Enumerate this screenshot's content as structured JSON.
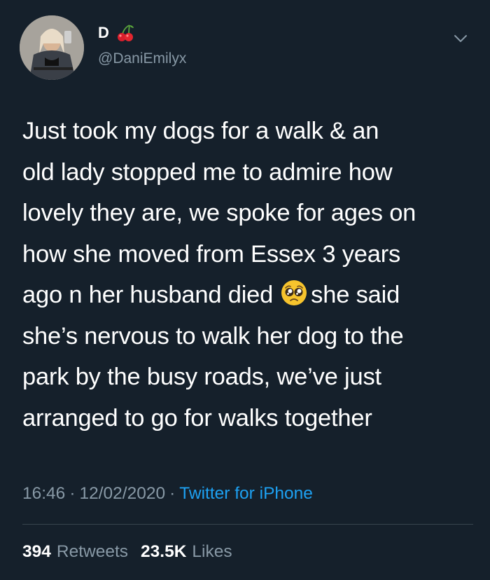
{
  "tweet": {
    "author": {
      "display_name": "D",
      "name_emoji": "cherries-icon",
      "handle": "@DaniEmilyx",
      "avatar": "avatar"
    },
    "text_lines": [
      "Just took my dogs for a walk & an",
      "old lady stopped me to admire how",
      "lovely they are, we spoke for ages on",
      "how she moved from Essex 3 years",
      "ago n her husband died",
      "she said",
      "she’s nervous to walk her dog to the",
      "park by the busy roads, we’ve just",
      "arranged to go for walks together"
    ],
    "inline_emoji": "pleading-face-icon",
    "meta": {
      "time": "16:46",
      "separator": "·",
      "date": "12/02/2020",
      "source": "Twitter for iPhone"
    },
    "stats": {
      "retweets_count": "394",
      "retweets_label": "Retweets",
      "likes_count": "23.5K",
      "likes_label": "Likes"
    },
    "menu_icon": "chevron-down-icon"
  },
  "colors": {
    "background": "#15202b",
    "primary_text": "#ffffff",
    "secondary_text": "#8899a6",
    "link": "#1da1f2",
    "divider": "#38444d"
  }
}
